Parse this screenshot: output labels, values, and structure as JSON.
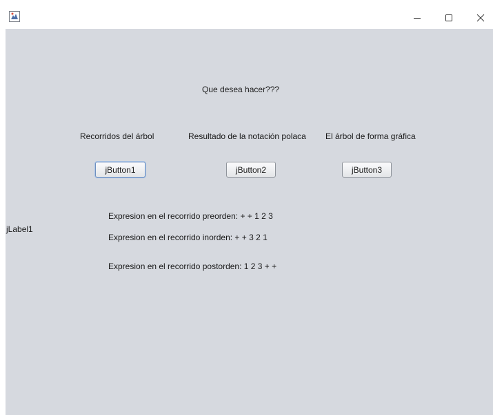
{
  "window": {
    "controls": {
      "minimize_glyph": "—",
      "maximize_glyph": "☐",
      "close_glyph": "✕"
    },
    "icon": "java-app-icon"
  },
  "content": {
    "prompt": "Que desea hacer???",
    "options": [
      {
        "label": "Recorridos del árbol",
        "button": "jButton1"
      },
      {
        "label": "Resultado de la notación polaca",
        "button": "jButton2"
      },
      {
        "label": "El árbol de forma gráfica",
        "button": "jButton3"
      }
    ],
    "side_label": "jLabel1",
    "expressions": {
      "preorden": "Expresion en el recorrido preorden: + + 1 2 3",
      "inorden": "Expresion en el recorrido inorden: + + 3 2 1",
      "postorden": "Expresion en el recorrido postorden: 1 2 3 + +"
    }
  }
}
